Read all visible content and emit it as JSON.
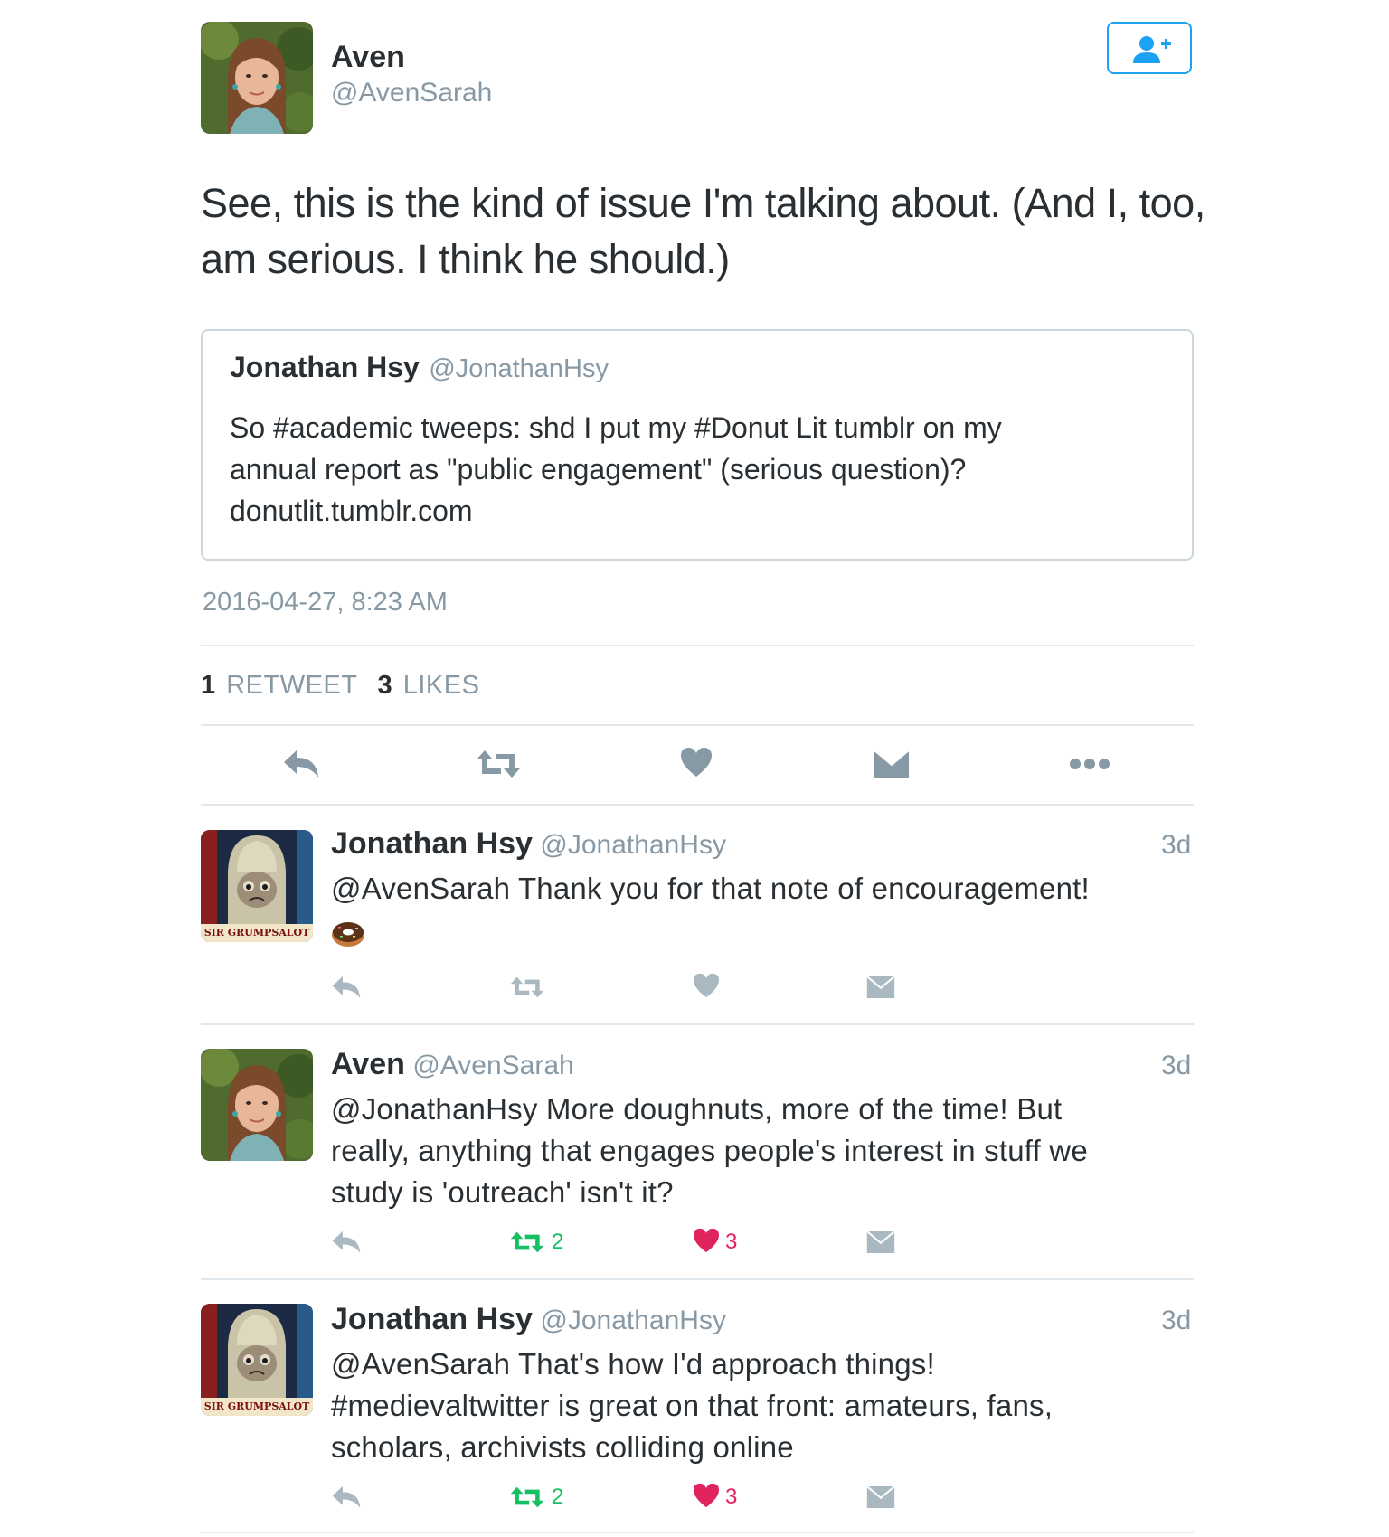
{
  "main_tweet": {
    "author_name": "Aven",
    "author_handle": "@AvenSarah",
    "text_line1": "See, this is the kind of issue I'm talking about. (And I, too,",
    "text_line2": "am serious. I think he should.)",
    "timestamp": "2016-04-27, 8:23 AM",
    "retweet_count": "1",
    "retweet_label": "RETWEET",
    "like_count": "3",
    "like_label": "LIKES",
    "follow_icon": "add-user-icon",
    "accent_color": "#1da1f2"
  },
  "quoted_tweet": {
    "author_name": "Jonathan Hsy",
    "author_handle": "@JonathanHsy",
    "text_line1": "So #academic tweeps: shd I put my #Donut Lit tumblr on my",
    "text_line2": "annual report as \"public engagement\" (serious question)?",
    "text_line3": "donutlit.tumblr.com"
  },
  "replies": [
    {
      "author_name": "Jonathan Hsy",
      "author_handle": "@JonathanHsy",
      "time": "3d",
      "avatar_caption": "SIR GRUMPSALOT",
      "lines": [
        "@AvenSarah Thank you for that note of encouragement!"
      ],
      "emoji": "donut",
      "retweets": "",
      "likes": ""
    },
    {
      "author_name": "Aven",
      "author_handle": "@AvenSarah",
      "time": "3d",
      "lines": [
        "@JonathanHsy More doughnuts, more of the time! But",
        "really, anything that engages people's interest in stuff we",
        "study is 'outreach' isn't it?"
      ],
      "retweets": "2",
      "likes": "3"
    },
    {
      "author_name": "Jonathan Hsy",
      "author_handle": "@JonathanHsy",
      "time": "3d",
      "avatar_caption": "SIR GRUMPSALOT",
      "lines": [
        "@AvenSarah That's how I'd approach things!",
        "#medievaltwitter is great on that front: amateurs, fans,",
        "scholars, archivists colliding online"
      ],
      "retweets": "2",
      "likes": "3"
    }
  ],
  "colors": {
    "retweet_active": "#17bf63",
    "like_active": "#e0245e",
    "icon_default": "#8899a6",
    "icon_light": "#aab8c2"
  }
}
